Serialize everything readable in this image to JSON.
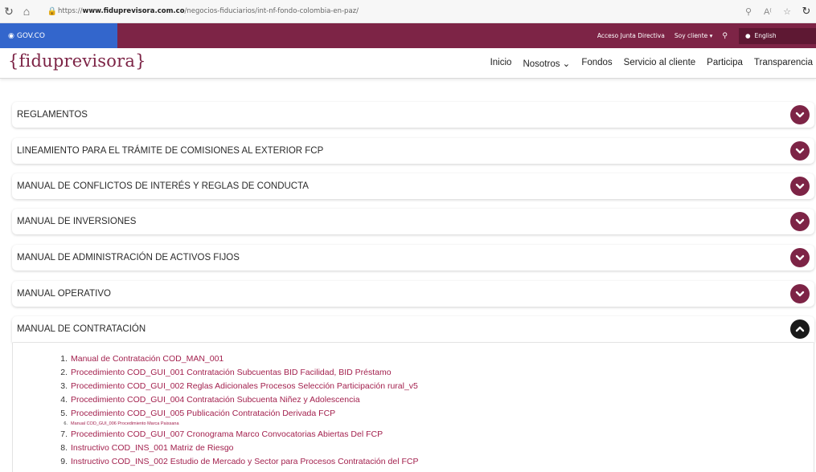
{
  "browser": {
    "url_prefix": "https://",
    "url_domain": "www.fiduprevisora.com.co",
    "url_path": "/negocios-fiduciarios/int-nf-fondo-colombia-en-paz/"
  },
  "gov_bar": {
    "brand": "GOV.CO",
    "links": [
      "Acceso Junta Directiva",
      "Soy cliente ▾"
    ],
    "language": "English"
  },
  "header": {
    "logo": "{fiduprevisora}",
    "nav": [
      "Inicio",
      "Nosotros ⌄",
      "Fondos",
      "Servicio al cliente",
      "Participa",
      "Transparencia"
    ]
  },
  "accordion": [
    {
      "title": "REGLAMENTOS",
      "open": false
    },
    {
      "title": "LINEAMIENTO PARA EL TRÁMITE DE COMISIONES AL EXTERIOR FCP",
      "open": false
    },
    {
      "title": "MANUAL DE CONFLICTOS DE INTERÉS Y REGLAS DE CONDUCTA",
      "open": false
    },
    {
      "title": "MANUAL DE INVERSIONES",
      "open": false
    },
    {
      "title": "MANUAL DE ADMINISTRACIÓN DE ACTIVOS FIJOS",
      "open": false
    },
    {
      "title": "MANUAL OPERATIVO",
      "open": false
    },
    {
      "title": "MANUAL DE CONTRATACIÓN",
      "open": true
    }
  ],
  "contratacion_docs": [
    {
      "num": "1.",
      "text": "Manual de Contratación COD_MAN_001"
    },
    {
      "num": "2.",
      "text": "Procedimiento COD_GUI_001 Contratación Subcuentas BID Facilidad, BID Préstamo"
    },
    {
      "num": "3.",
      "text": "Procedimiento COD_GUI_002 Reglas Adicionales Procesos Selección Participación rural_v5"
    },
    {
      "num": "4.",
      "text": "Procedimiento COD_GUI_004 Contratación Subcuenta Niñez y Adolescencia"
    },
    {
      "num": "5.",
      "text": "Procedimiento COD_GUI_005 Publicación Contratación Derivada FCP"
    },
    {
      "num": "6.",
      "text": "Manual COD_GUI_006 Procedimiento Marca Paissana"
    },
    {
      "num": "7.",
      "text": "Procedimiento COD_GUI_007 Cronograma Marco Convocatorias Abiertas Del FCP"
    },
    {
      "num": "8.",
      "text": "Instructivo COD_INS_001 Matriz de Riesgo"
    },
    {
      "num": "9.",
      "text": "Instructivo COD_INS_002 Estudio de Mercado y Sector para Procesos Contratación del FCP"
    }
  ],
  "colors": {
    "brand": "#7d2446",
    "gov_blue": "#3366cc",
    "link": "#a3214e"
  }
}
